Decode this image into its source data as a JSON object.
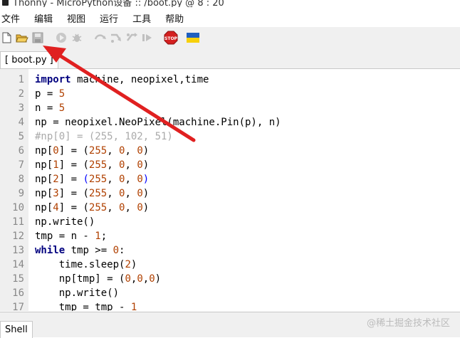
{
  "window": {
    "title": "Thonny  -  MicroPython设备 :: /boot.py  @  8 : 20"
  },
  "menu": [
    "文件",
    "编辑",
    "视图",
    "运行",
    "工具",
    "帮助"
  ],
  "toolbar": {
    "icons": [
      "new-file-icon",
      "open-file-icon",
      "save-file-icon",
      "run-icon",
      "debug-icon",
      "step-over-icon",
      "step-into-icon",
      "step-out-icon",
      "resume-icon",
      "stop-icon",
      "ukraine-flag-icon"
    ],
    "stop_label": "STOP",
    "colors": {
      "stop": "#d42020",
      "flag_blue": "#1f5fbf",
      "flag_yellow": "#f7d00b",
      "arrow": "#e02020"
    }
  },
  "tab": {
    "label": "[ boot.py ]"
  },
  "editor": {
    "lines": [
      {
        "n": "1",
        "parts": [
          [
            "kw",
            "import"
          ],
          [
            "t",
            " machine, neopixel,time"
          ]
        ]
      },
      {
        "n": "2",
        "parts": [
          [
            "t",
            "p = "
          ],
          [
            "num",
            "5"
          ]
        ]
      },
      {
        "n": "3",
        "parts": [
          [
            "t",
            "n = "
          ],
          [
            "num",
            "5"
          ]
        ]
      },
      {
        "n": "4",
        "parts": [
          [
            "t",
            "np = neopixel.NeoPixel(machine.Pin(p), n)"
          ]
        ]
      },
      {
        "n": "5",
        "parts": [
          [
            "cmt",
            "#np[0] = (255, 102, 51)"
          ]
        ]
      },
      {
        "n": "6",
        "parts": [
          [
            "t",
            "np["
          ],
          [
            "num",
            "0"
          ],
          [
            "t",
            "] = ("
          ],
          [
            "num",
            "255"
          ],
          [
            "t",
            ", "
          ],
          [
            "num",
            "0"
          ],
          [
            "t",
            ", "
          ],
          [
            "num",
            "0"
          ],
          [
            "t",
            ")"
          ]
        ]
      },
      {
        "n": "7",
        "parts": [
          [
            "t",
            "np["
          ],
          [
            "num",
            "1"
          ],
          [
            "t",
            "] = ("
          ],
          [
            "num",
            "255"
          ],
          [
            "t",
            ", "
          ],
          [
            "num",
            "0"
          ],
          [
            "t",
            ", "
          ],
          [
            "num",
            "0"
          ],
          [
            "t",
            ")"
          ]
        ]
      },
      {
        "n": "8",
        "parts": [
          [
            "t",
            "np["
          ],
          [
            "num",
            "2"
          ],
          [
            "t",
            "] = "
          ],
          [
            "br",
            "("
          ],
          [
            "num",
            "255"
          ],
          [
            "t",
            ", "
          ],
          [
            "num",
            "0"
          ],
          [
            "t",
            ", "
          ],
          [
            "num",
            "0"
          ],
          [
            "br",
            ")"
          ]
        ]
      },
      {
        "n": "9",
        "parts": [
          [
            "t",
            "np["
          ],
          [
            "num",
            "3"
          ],
          [
            "t",
            "] = ("
          ],
          [
            "num",
            "255"
          ],
          [
            "t",
            ", "
          ],
          [
            "num",
            "0"
          ],
          [
            "t",
            ", "
          ],
          [
            "num",
            "0"
          ],
          [
            "t",
            ")"
          ]
        ]
      },
      {
        "n": "10",
        "parts": [
          [
            "t",
            "np["
          ],
          [
            "num",
            "4"
          ],
          [
            "t",
            "] = ("
          ],
          [
            "num",
            "255"
          ],
          [
            "t",
            ", "
          ],
          [
            "num",
            "0"
          ],
          [
            "t",
            ", "
          ],
          [
            "num",
            "0"
          ],
          [
            "t",
            ")"
          ]
        ]
      },
      {
        "n": "11",
        "parts": [
          [
            "t",
            "np.write()"
          ]
        ]
      },
      {
        "n": "12",
        "parts": [
          [
            "t",
            "tmp = n - "
          ],
          [
            "num",
            "1"
          ],
          [
            "t",
            ";"
          ]
        ]
      },
      {
        "n": "13",
        "parts": [
          [
            "kw",
            "while"
          ],
          [
            "t",
            " tmp >= "
          ],
          [
            "num",
            "0"
          ],
          [
            "t",
            ":"
          ]
        ]
      },
      {
        "n": "14",
        "parts": [
          [
            "t",
            "    time.sleep("
          ],
          [
            "num",
            "2"
          ],
          [
            "t",
            ")"
          ]
        ]
      },
      {
        "n": "15",
        "parts": [
          [
            "t",
            "    np[tmp] = ("
          ],
          [
            "num",
            "0"
          ],
          [
            "t",
            ","
          ],
          [
            "num",
            "0"
          ],
          [
            "t",
            ","
          ],
          [
            "num",
            "0"
          ],
          [
            "t",
            ")"
          ]
        ]
      },
      {
        "n": "16",
        "parts": [
          [
            "t",
            "    np.write()"
          ]
        ]
      },
      {
        "n": "17",
        "parts": [
          [
            "t",
            "    tmp = tmp - "
          ],
          [
            "num",
            "1"
          ]
        ]
      }
    ]
  },
  "shell": {
    "label": "Shell"
  },
  "watermark": "@稀土掘金技术社区"
}
